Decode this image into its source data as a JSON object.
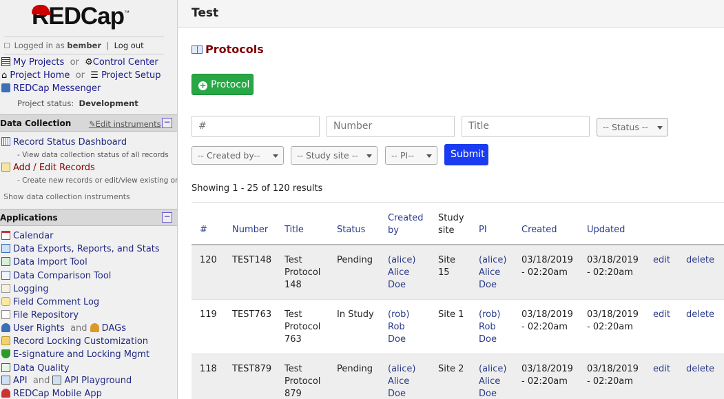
{
  "logo": {
    "text": "REDCap",
    "tm": "™"
  },
  "login": {
    "prefix": "Logged in as",
    "user": "bember",
    "sep": "|",
    "logout": "Log out"
  },
  "nav": {
    "my_projects": "My Projects",
    "or1": "or",
    "control_center": "Control Center",
    "project_home": "Project Home",
    "or2": "or",
    "project_setup": "Project Setup",
    "messenger": "REDCap Messenger",
    "status_label": "Project status:",
    "status_value": "Development"
  },
  "data_collection": {
    "header": "Data Collection",
    "edit": "Edit instruments",
    "minus": "−",
    "items": [
      {
        "label": "Record Status Dashboard",
        "sub": "- View data collection status of all records"
      },
      {
        "label": "Add / Edit Records",
        "sub": "- Create new records or edit/view existing ones"
      }
    ],
    "show_instruments": "Show data collection instruments"
  },
  "applications": {
    "header": "Applications",
    "minus": "−",
    "items": [
      "Calendar",
      "Data Exports, Reports, and Stats",
      "Data Import Tool",
      "Data Comparison Tool",
      "Logging",
      "Field Comment Log",
      "File Repository",
      "User Rights",
      "Record Locking Customization",
      "E-signature and Locking Mgmt",
      "Data Quality",
      "API",
      "REDCap Mobile App"
    ],
    "user_rights_and": "and",
    "dags": "DAGs",
    "api_and": "and",
    "api_playground": "API Playground"
  },
  "topbar": {
    "title": "Test"
  },
  "page": {
    "title": "Protocols",
    "add_button": "Protocol"
  },
  "filters": {
    "num_placeholder": "#",
    "number_placeholder": "Number",
    "title_placeholder": "Title",
    "status": "-- Status --",
    "created_by": "-- Created by--",
    "study_site": "-- Study site --",
    "pi": "-- PI--",
    "submit": "Submit"
  },
  "results": {
    "showing": "Showing 1 - 25 of 120 results"
  },
  "table": {
    "headers": {
      "num": "#",
      "number": "Number",
      "title": "Title",
      "status": "Status",
      "created_by_1": "Created",
      "created_by_2": "by",
      "site_1": "Study",
      "site_2": "site",
      "pi": "PI",
      "created": "Created",
      "updated": "Updated"
    },
    "rows": [
      {
        "num": "120",
        "number": "TEST148",
        "title": [
          "Test",
          "Protocol",
          "148"
        ],
        "status": "Pending",
        "created_by": [
          "(alice)",
          "Alice",
          "Doe"
        ],
        "site": [
          "Site",
          "15"
        ],
        "pi": [
          "(alice)",
          "Alice",
          "Doe"
        ],
        "created": [
          "03/18/2019",
          "- 02:20am"
        ],
        "updated": [
          "03/18/2019",
          "- 02:20am"
        ],
        "edit": "edit",
        "delete": "delete"
      },
      {
        "num": "119",
        "number": "TEST763",
        "title": [
          "Test",
          "Protocol",
          "763"
        ],
        "status": "In Study",
        "created_by": [
          "(rob)",
          "Rob",
          "Doe"
        ],
        "site": [
          "Site 1"
        ],
        "pi": [
          "(rob)",
          "Rob",
          "Doe"
        ],
        "created": [
          "03/18/2019",
          "- 02:20am"
        ],
        "updated": [
          "03/18/2019",
          "- 02:20am"
        ],
        "edit": "edit",
        "delete": "delete"
      },
      {
        "num": "118",
        "number": "TEST879",
        "title": [
          "Test",
          "Protocol",
          "879"
        ],
        "status": "Pending",
        "created_by": [
          "(alice)",
          "Alice",
          "Doe"
        ],
        "site": [
          "Site 2"
        ],
        "pi": [
          "(alice)",
          "Alice",
          "Doe"
        ],
        "created": [
          "03/18/2019",
          "- 02:20am"
        ],
        "updated": [
          "03/18/2019",
          "- 02:20am"
        ],
        "edit": "edit",
        "delete": "delete"
      }
    ]
  }
}
